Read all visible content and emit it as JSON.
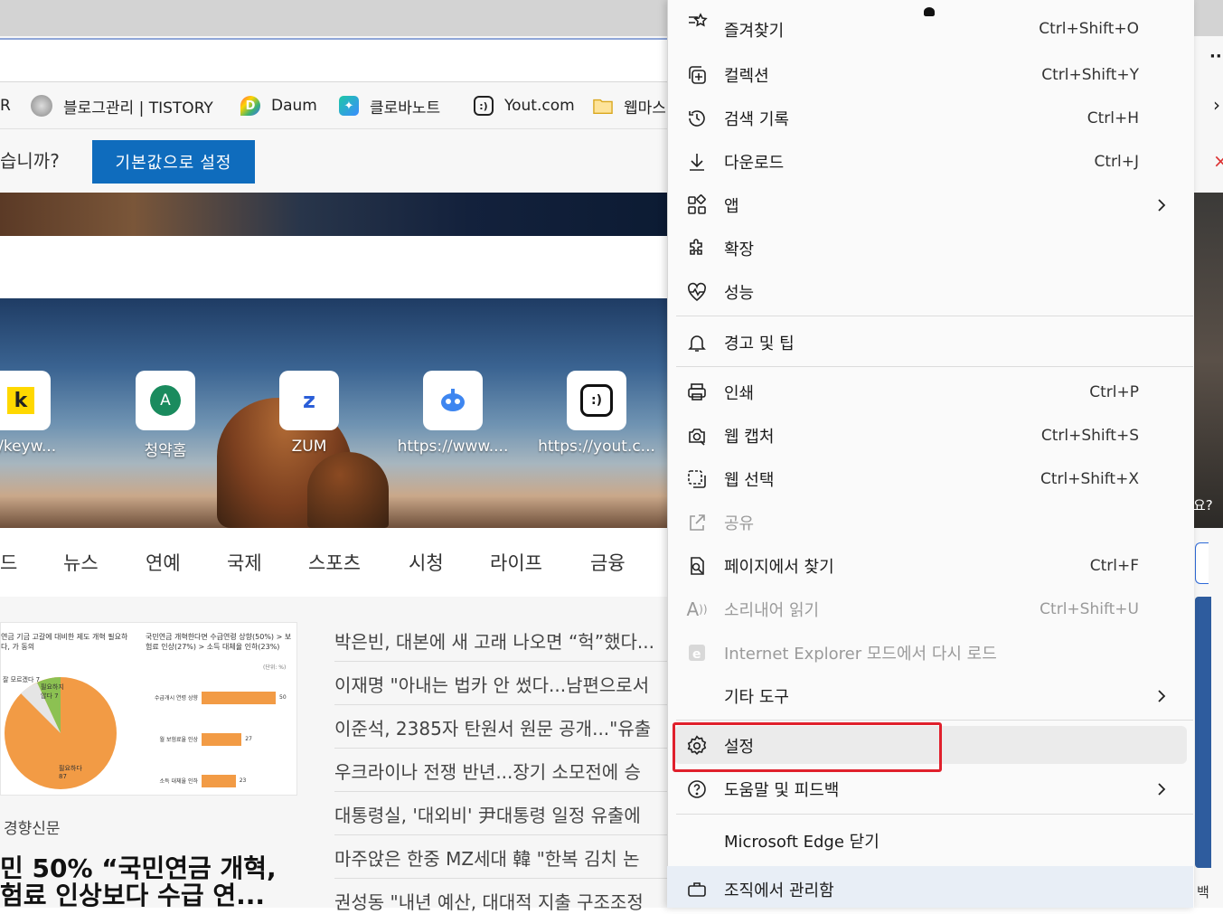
{
  "favorites": [
    {
      "label": "R",
      "icon": "bookmark-icon"
    },
    {
      "label": "블로그관리 | TISTORY",
      "icon": "tistory-icon"
    },
    {
      "label": "Daum",
      "icon": "daum-icon"
    },
    {
      "label": "클로바노트",
      "icon": "clova-icon"
    },
    {
      "label": "Yout.com",
      "icon": "yout-icon"
    },
    {
      "label": "웹마스",
      "icon": "folder-icon"
    }
  ],
  "infobar": {
    "text": "습니까?",
    "button": "기본값으로 설정"
  },
  "tiles": [
    {
      "label": "s://keyw...",
      "letter": "k"
    },
    {
      "label": "청약홈",
      "letter": "A"
    },
    {
      "label": "ZUM",
      "letter": "z"
    },
    {
      "label": "https://www....",
      "letter": ""
    },
    {
      "label": "https://yout.c...",
      "letter": ""
    }
  ],
  "news_nav": [
    "드",
    "뉴스",
    "연예",
    "국제",
    "스포츠",
    "시청",
    "라이프",
    "금융"
  ],
  "news": {
    "source": "경향신문",
    "headline1": "민 50% “국민연금 개혁,",
    "headline2": "험료 인상보다 수급 연...",
    "lines": [
      "박은빈, 대본에 새 고래 나오면 “헉”했다...",
      "이재명 \"아내는 법카 안 썼다...남편으로서",
      "이준석, 2385자 탄원서 원문 공개...\"유출",
      "우크라이나 전쟁 반년...장기 소모전에 승",
      "대통령실, '대외비' 尹대통령 일정 유출에",
      "마주앉은 한중 MZ세대 韓 \"한복 김치 논",
      "권성동 \"내년 예산, 대대적 지출 구조조정"
    ],
    "chart_left_title": "연금 기금 고갈에 대비한 제도 개혁 필요하다, 가 동의",
    "chart_left_values": [
      "잘 모르겠다 7",
      "필요하지 않다 7",
      "필요하다 87"
    ],
    "chart_right_title": "국민연금 개혁한다면 수급연령 상향(50%) > 보험료 인상(27%) > 소득 대체율 인하(23%)",
    "chart_right_unit": "(단위: %)",
    "chart_right_bars": [
      {
        "label": "수급개시 연령 상향",
        "value": 50
      },
      {
        "label": "월 보험료율 인상",
        "value": 27
      },
      {
        "label": "소득 대체율 인하",
        "value": 23
      }
    ]
  },
  "right_edge": {
    "text1": "요?",
    "text2": "백"
  },
  "menu": {
    "items": [
      {
        "label": "즐겨찾기",
        "key": "Ctrl+Shift+O",
        "icon": "favorites-icon"
      },
      {
        "label": "컬렉션",
        "key": "Ctrl+Shift+Y",
        "icon": "collections-icon"
      },
      {
        "label": "검색 기록",
        "key": "Ctrl+H",
        "icon": "history-icon"
      },
      {
        "label": "다운로드",
        "key": "Ctrl+J",
        "icon": "download-icon"
      },
      {
        "label": "앱",
        "key": "",
        "icon": "apps-icon"
      },
      {
        "label": "확장",
        "key": "",
        "icon": "extensions-icon"
      },
      {
        "label": "성능",
        "key": "",
        "icon": "performance-icon"
      },
      {
        "label": "경고 및 팁",
        "key": "",
        "icon": "bell-icon"
      },
      {
        "label": "인쇄",
        "key": "Ctrl+P",
        "icon": "print-icon"
      },
      {
        "label": "웹 캡처",
        "key": "Ctrl+Shift+S",
        "icon": "web-capture-icon"
      },
      {
        "label": "웹 선택",
        "key": "Ctrl+Shift+X",
        "icon": "web-select-icon"
      },
      {
        "label": "공유",
        "key": "",
        "icon": "share-icon"
      },
      {
        "label": "페이지에서 찾기",
        "key": "Ctrl+F",
        "icon": "find-icon"
      },
      {
        "label": "소리내어 읽기",
        "key": "Ctrl+Shift+U",
        "icon": "read-aloud-icon"
      },
      {
        "label": "Internet Explorer 모드에서 다시 로드",
        "key": "",
        "icon": "ie-icon"
      },
      {
        "label": "기타 도구",
        "key": "",
        "icon": "more-tools-icon"
      },
      {
        "label": "설정",
        "key": "",
        "icon": "gear-icon"
      },
      {
        "label": "도움말 및 피드백",
        "key": "",
        "icon": "help-icon"
      },
      {
        "label": "Microsoft Edge 닫기",
        "key": "",
        "icon": ""
      },
      {
        "label": "조직에서 관리함",
        "key": "",
        "icon": "briefcase-icon"
      }
    ]
  }
}
